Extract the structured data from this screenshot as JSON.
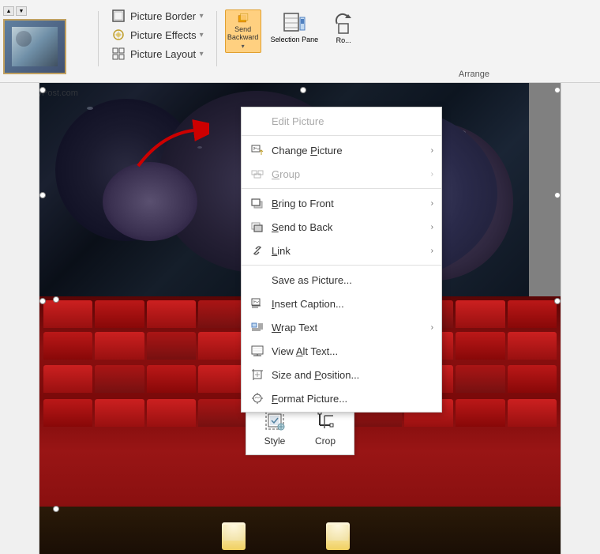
{
  "ribbon": {
    "items": [
      {
        "id": "picture-border",
        "label": "Picture Border",
        "icon": "🖼",
        "hasArrow": true
      },
      {
        "id": "picture-effects",
        "label": "Picture Effects",
        "icon": "✨",
        "hasArrow": true
      },
      {
        "id": "picture-layout",
        "label": "Picture Layout",
        "icon": "⊞",
        "hasArrow": true
      }
    ],
    "right_buttons": [
      {
        "id": "send-backward",
        "label": "Send\nBackward",
        "hasDropdown": true
      },
      {
        "id": "selection-pane",
        "label": "Selection\nPane"
      },
      {
        "id": "rotate",
        "label": "Ro..."
      }
    ],
    "arrange_label": "Arrange"
  },
  "context_menu": {
    "items": [
      {
        "id": "edit-picture",
        "label": "Edit Picture",
        "icon": "",
        "disabled": true,
        "hasArrow": false
      },
      {
        "id": "change-picture",
        "label": "Change Picture",
        "icon": "🔄",
        "disabled": false,
        "hasArrow": true,
        "underline": "P"
      },
      {
        "id": "group",
        "label": "Group",
        "icon": "⊞",
        "disabled": true,
        "hasArrow": true
      },
      {
        "id": "bring-to-front",
        "label": "Bring to Front",
        "icon": "📋",
        "disabled": false,
        "hasArrow": true
      },
      {
        "id": "send-to-back",
        "label": "Send to Back",
        "icon": "📋",
        "disabled": false,
        "hasArrow": true
      },
      {
        "id": "link",
        "label": "Link",
        "icon": "🔗",
        "disabled": false,
        "hasArrow": true
      },
      {
        "id": "save-as-picture",
        "label": "Save as Picture...",
        "icon": "",
        "disabled": false,
        "hasArrow": false
      },
      {
        "id": "insert-caption",
        "label": "Insert Caption...",
        "icon": "🖼",
        "disabled": false,
        "hasArrow": false
      },
      {
        "id": "wrap-text",
        "label": "Wrap Text",
        "icon": "↩",
        "disabled": false,
        "hasArrow": true
      },
      {
        "id": "view-alt-text",
        "label": "View Alt Text...",
        "icon": "⊟",
        "disabled": false,
        "hasArrow": false
      },
      {
        "id": "size-and-position",
        "label": "Size and Position...",
        "icon": "⊟",
        "disabled": false,
        "hasArrow": false
      },
      {
        "id": "format-picture",
        "label": "Format Picture...",
        "icon": "⊟",
        "disabled": false,
        "hasArrow": false
      }
    ]
  },
  "mini_toolbar": {
    "items": [
      {
        "id": "style",
        "label": "Style",
        "icon": "style"
      },
      {
        "id": "crop",
        "label": "Crop",
        "icon": "crop"
      }
    ]
  },
  "watermark": {
    "text": "groovyPost.com"
  },
  "separators": [
    1,
    2,
    5
  ],
  "colors": {
    "accent_orange": "#ffd080",
    "ribbon_bg": "#f3f3f3",
    "menu_hover": "#cce4f7",
    "context_border": "#cccccc"
  }
}
